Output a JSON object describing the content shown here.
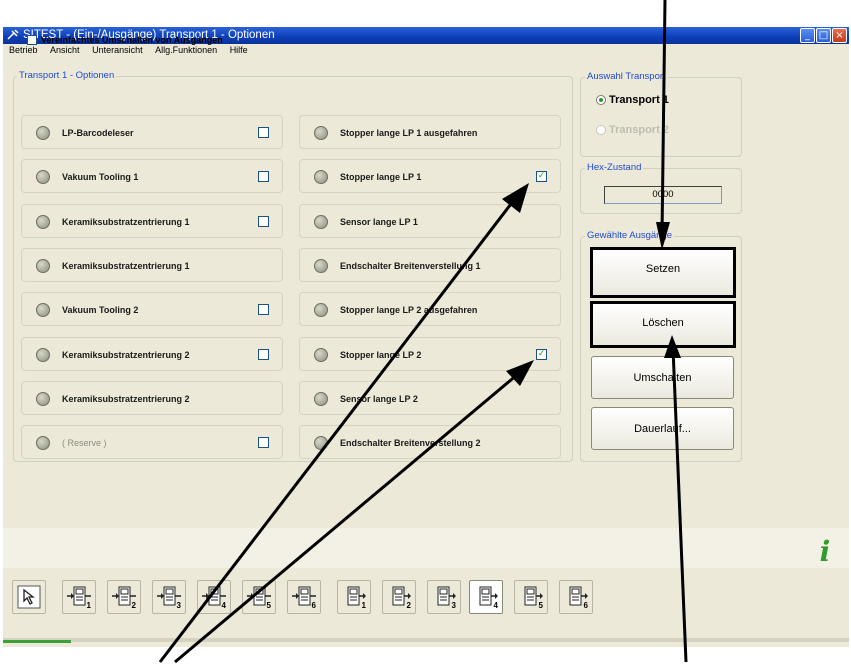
{
  "window": {
    "title": "SITEST - (Ein-/Ausgänge) Transport 1 - Optionen",
    "controls": [
      "_",
      "□",
      "×"
    ]
  },
  "menu": [
    "Betrieb",
    "Ansicht",
    "Unteransicht",
    "Allg.Funktionen",
    "Hilfe"
  ],
  "options_group": {
    "title": "Transport 1 - Optionen",
    "simplified_switch_label": "Vereinfachtes Umschalten von Ausgängen",
    "left_rows": [
      {
        "label": "LP-Barcodeleser",
        "checkbox": true,
        "checked": false,
        "disabled": false
      },
      {
        "label": "Vakuum Tooling 1",
        "checkbox": true,
        "checked": false,
        "disabled": false
      },
      {
        "label": "Keramiksubstratzentrierung 1",
        "checkbox": true,
        "checked": false,
        "disabled": false
      },
      {
        "label": "Keramiksubstratzentrierung 1",
        "checkbox": false,
        "checked": false,
        "disabled": false
      },
      {
        "label": "Vakuum Tooling 2",
        "checkbox": true,
        "checked": false,
        "disabled": false
      },
      {
        "label": "Keramiksubstratzentrierung 2",
        "checkbox": true,
        "checked": false,
        "disabled": false
      },
      {
        "label": "Keramiksubstratzentrierung 2",
        "checkbox": false,
        "checked": false,
        "disabled": false
      },
      {
        "label": "( Reserve )",
        "checkbox": true,
        "checked": false,
        "disabled": true
      }
    ],
    "right_rows": [
      {
        "label": "Stopper lange LP 1 ausgefahren",
        "checkbox": false,
        "checked": false
      },
      {
        "label": "Stopper lange LP 1",
        "checkbox": true,
        "checked": true
      },
      {
        "label": "Sensor lange LP 1",
        "checkbox": false,
        "checked": false
      },
      {
        "label": "Endschalter Breitenverstellung 1",
        "checkbox": false,
        "checked": false
      },
      {
        "label": "Stopper lange LP 2 ausgefahren",
        "checkbox": false,
        "checked": false
      },
      {
        "label": "Stopper lange LP 2",
        "checkbox": true,
        "checked": true
      },
      {
        "label": "Sensor lange LP 2",
        "checkbox": false,
        "checked": false
      },
      {
        "label": "Endschalter Breitenverstellung 2",
        "checkbox": false,
        "checked": false
      }
    ]
  },
  "transport_group": {
    "title": "Auswahl Transport",
    "options": [
      {
        "label": "Transport 1",
        "selected": true,
        "enabled": true
      },
      {
        "label": "Transport 2",
        "selected": false,
        "enabled": false
      }
    ]
  },
  "hex_group": {
    "title": "Hex-Zustand",
    "value": "0000"
  },
  "outputs_group": {
    "title": "Gewählte Ausgänge",
    "buttons": [
      "Setzen",
      "Löschen",
      "Umschalten",
      "Dauerlauf..."
    ]
  },
  "toolbar": {
    "items": [
      "1",
      "2",
      "3",
      "4",
      "5",
      "6",
      "1",
      "2",
      "3",
      "4",
      "5",
      "6"
    ],
    "selected_index": 9
  },
  "colors": {
    "title_bar": "#0d3fb8",
    "group_title": "#1f4bd0",
    "face": "#ece9d8",
    "checked": "#21a121",
    "info_icon": "#2e9d2e"
  },
  "icons": [
    "pointer-icon",
    "input-module-icon",
    "output-module-icon",
    "info-icon",
    "app-icon"
  ]
}
